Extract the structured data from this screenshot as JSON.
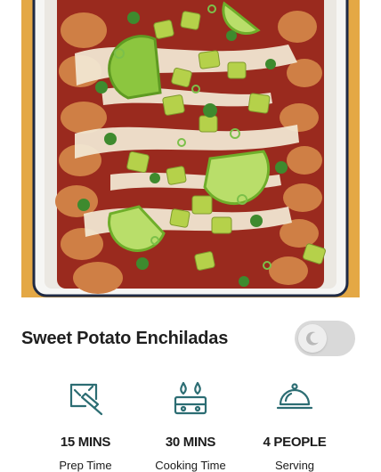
{
  "recipe": {
    "title": "Sweet Potato Enchiladas"
  },
  "theme_toggle": {
    "state": "off",
    "icon": "moon-icon"
  },
  "stats": [
    {
      "value": "15 MINS",
      "label": "Prep Time",
      "icon": "prep-knife-icon"
    },
    {
      "value": "30 MINS",
      "label": "Cooking Time",
      "icon": "stove-burner-icon"
    },
    {
      "value": "4 PEOPLE",
      "label": "Serving",
      "icon": "serving-cloche-icon"
    }
  ],
  "colors": {
    "accent": "#2c6d73",
    "toggle_track": "#d9d9d9",
    "background_wood": "#e9b24f"
  }
}
